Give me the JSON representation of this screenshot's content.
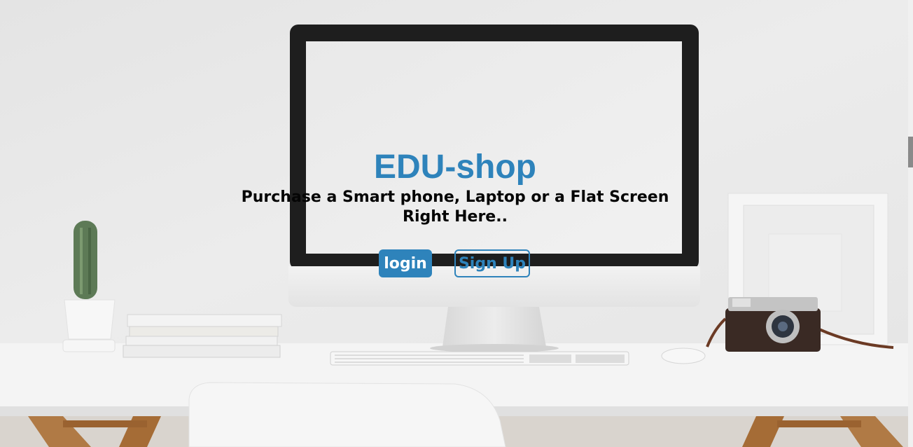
{
  "brand": {
    "title": "EDU-shop",
    "accent_color": "#2e83bb"
  },
  "hero": {
    "tagline": "Purchase a Smart phone, Laptop or a Flat Screen Right Here.."
  },
  "actions": {
    "login_label": "login",
    "signup_label": "Sign Up"
  },
  "background": {
    "description_icons": [
      "monitor-icon",
      "keyboard-icon",
      "mouse-icon",
      "camera-icon",
      "cactus-icon",
      "books-icon",
      "picture-frame-icon",
      "chair-icon"
    ]
  }
}
